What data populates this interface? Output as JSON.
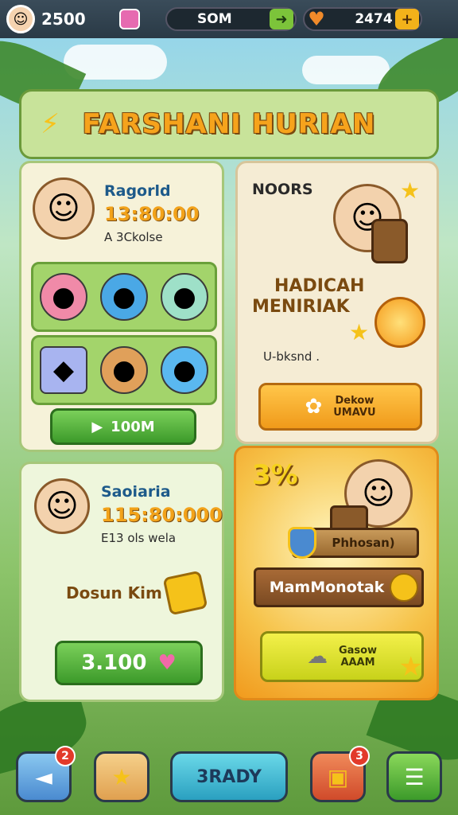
{
  "topbar": {
    "coins": "2500",
    "som_label": "SOM",
    "som_plus": "➜",
    "hearts": "2474",
    "hearts_plus": "+"
  },
  "title": "FARSHANI HURIAN",
  "card_a": {
    "name": "Ragorld",
    "time": "13:80:00",
    "subtitle": "A 3Ckolse",
    "button_label": "100M"
  },
  "card_b": {
    "header": "NOORS",
    "reward_title_line1": "HADICAH",
    "reward_title_line2": "MENIRIAK",
    "caption": "U-bksnd .",
    "button_line1": "Dekow",
    "button_line2": "UMAVU"
  },
  "card_c": {
    "name": "Saoiaria",
    "time": "115:80:000",
    "subtitle": "E13 ols wela",
    "label": "Dosun Kim",
    "button_label": "3.100"
  },
  "card_d": {
    "percent": "3%",
    "tag": "Phhosan)",
    "banner": "MamMonotak",
    "button_line1": "Gasow",
    "button_line2": "AAAM"
  },
  "nav": {
    "left_badge": "2",
    "center_label": "3RADY",
    "chat_badge": "3"
  },
  "colors": {
    "accent_orange": "#f6a31c",
    "green": "#3c9a2a",
    "badge_red": "#e23a2a"
  }
}
